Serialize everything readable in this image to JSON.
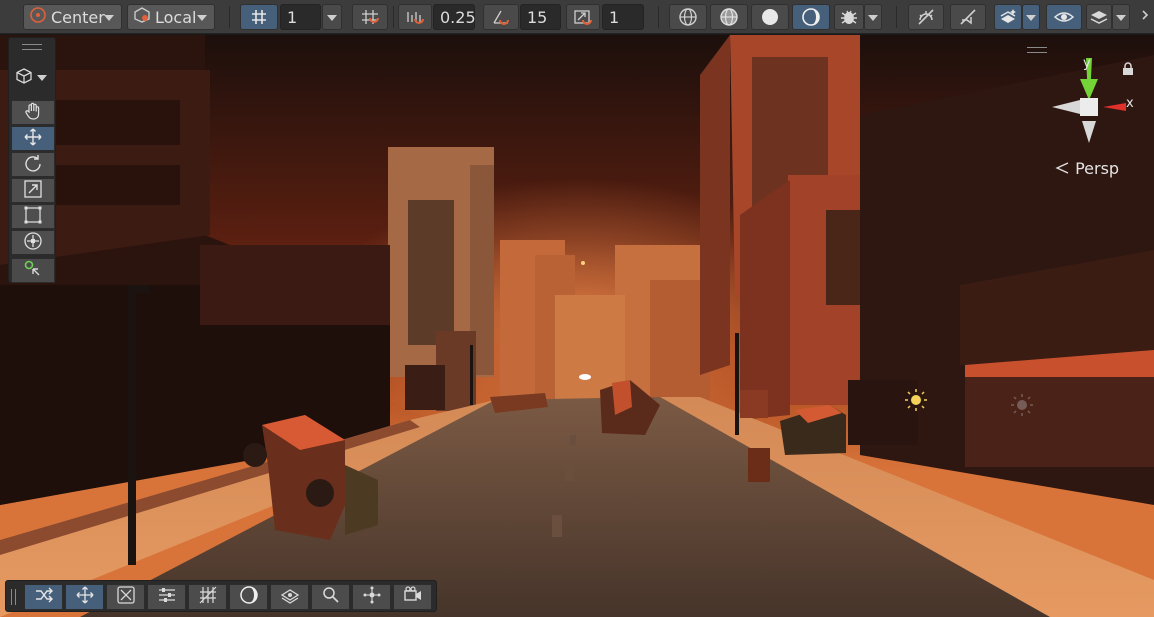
{
  "toolbar": {
    "pivot_mode": {
      "label": "Center",
      "icon": "pivot-center-icon"
    },
    "pivot_rotation": {
      "label": "Local",
      "icon": "local-rotation-icon"
    },
    "grid_snap_value": "1",
    "increment_snap_value": "0.25",
    "rotation_snap_value": "15",
    "scale_snap_value": "1",
    "icons": [
      "grid-icon",
      "grid-snap-icon",
      "increment-snap-icon",
      "rotation-snap-icon",
      "scale-snap-icon",
      "shading-wireframe-icon",
      "shading-shaded-wireframe-icon",
      "shading-shaded-icon",
      "shading-lit-icon",
      "debug-draw-icon",
      "lighting-toggle-icon",
      "audio-toggle-icon",
      "effects-icon",
      "visibility-icon",
      "layers-icon"
    ]
  },
  "left_tools": [
    "hand-tool-icon",
    "move-tool-icon",
    "rotate-tool-icon",
    "scale-tool-icon",
    "rect-tool-icon",
    "transform-tool-icon",
    "custom-tool-icon"
  ],
  "gizmo": {
    "y_label": "y",
    "x_label": "x",
    "projection_label": "Persp"
  },
  "bottom_overlay": [
    "toggle-icon",
    "move-icon",
    "navigate-icon",
    "align-icon",
    "grid-icon",
    "shading-icon",
    "layers-icon",
    "search-icon",
    "pivot-icon",
    "camera-icon"
  ],
  "colors": {
    "accent": "#46607c",
    "toolbar_bg": "#3c3c3c",
    "gizmo_x": "#e0302a",
    "gizmo_y": "#74d437"
  }
}
